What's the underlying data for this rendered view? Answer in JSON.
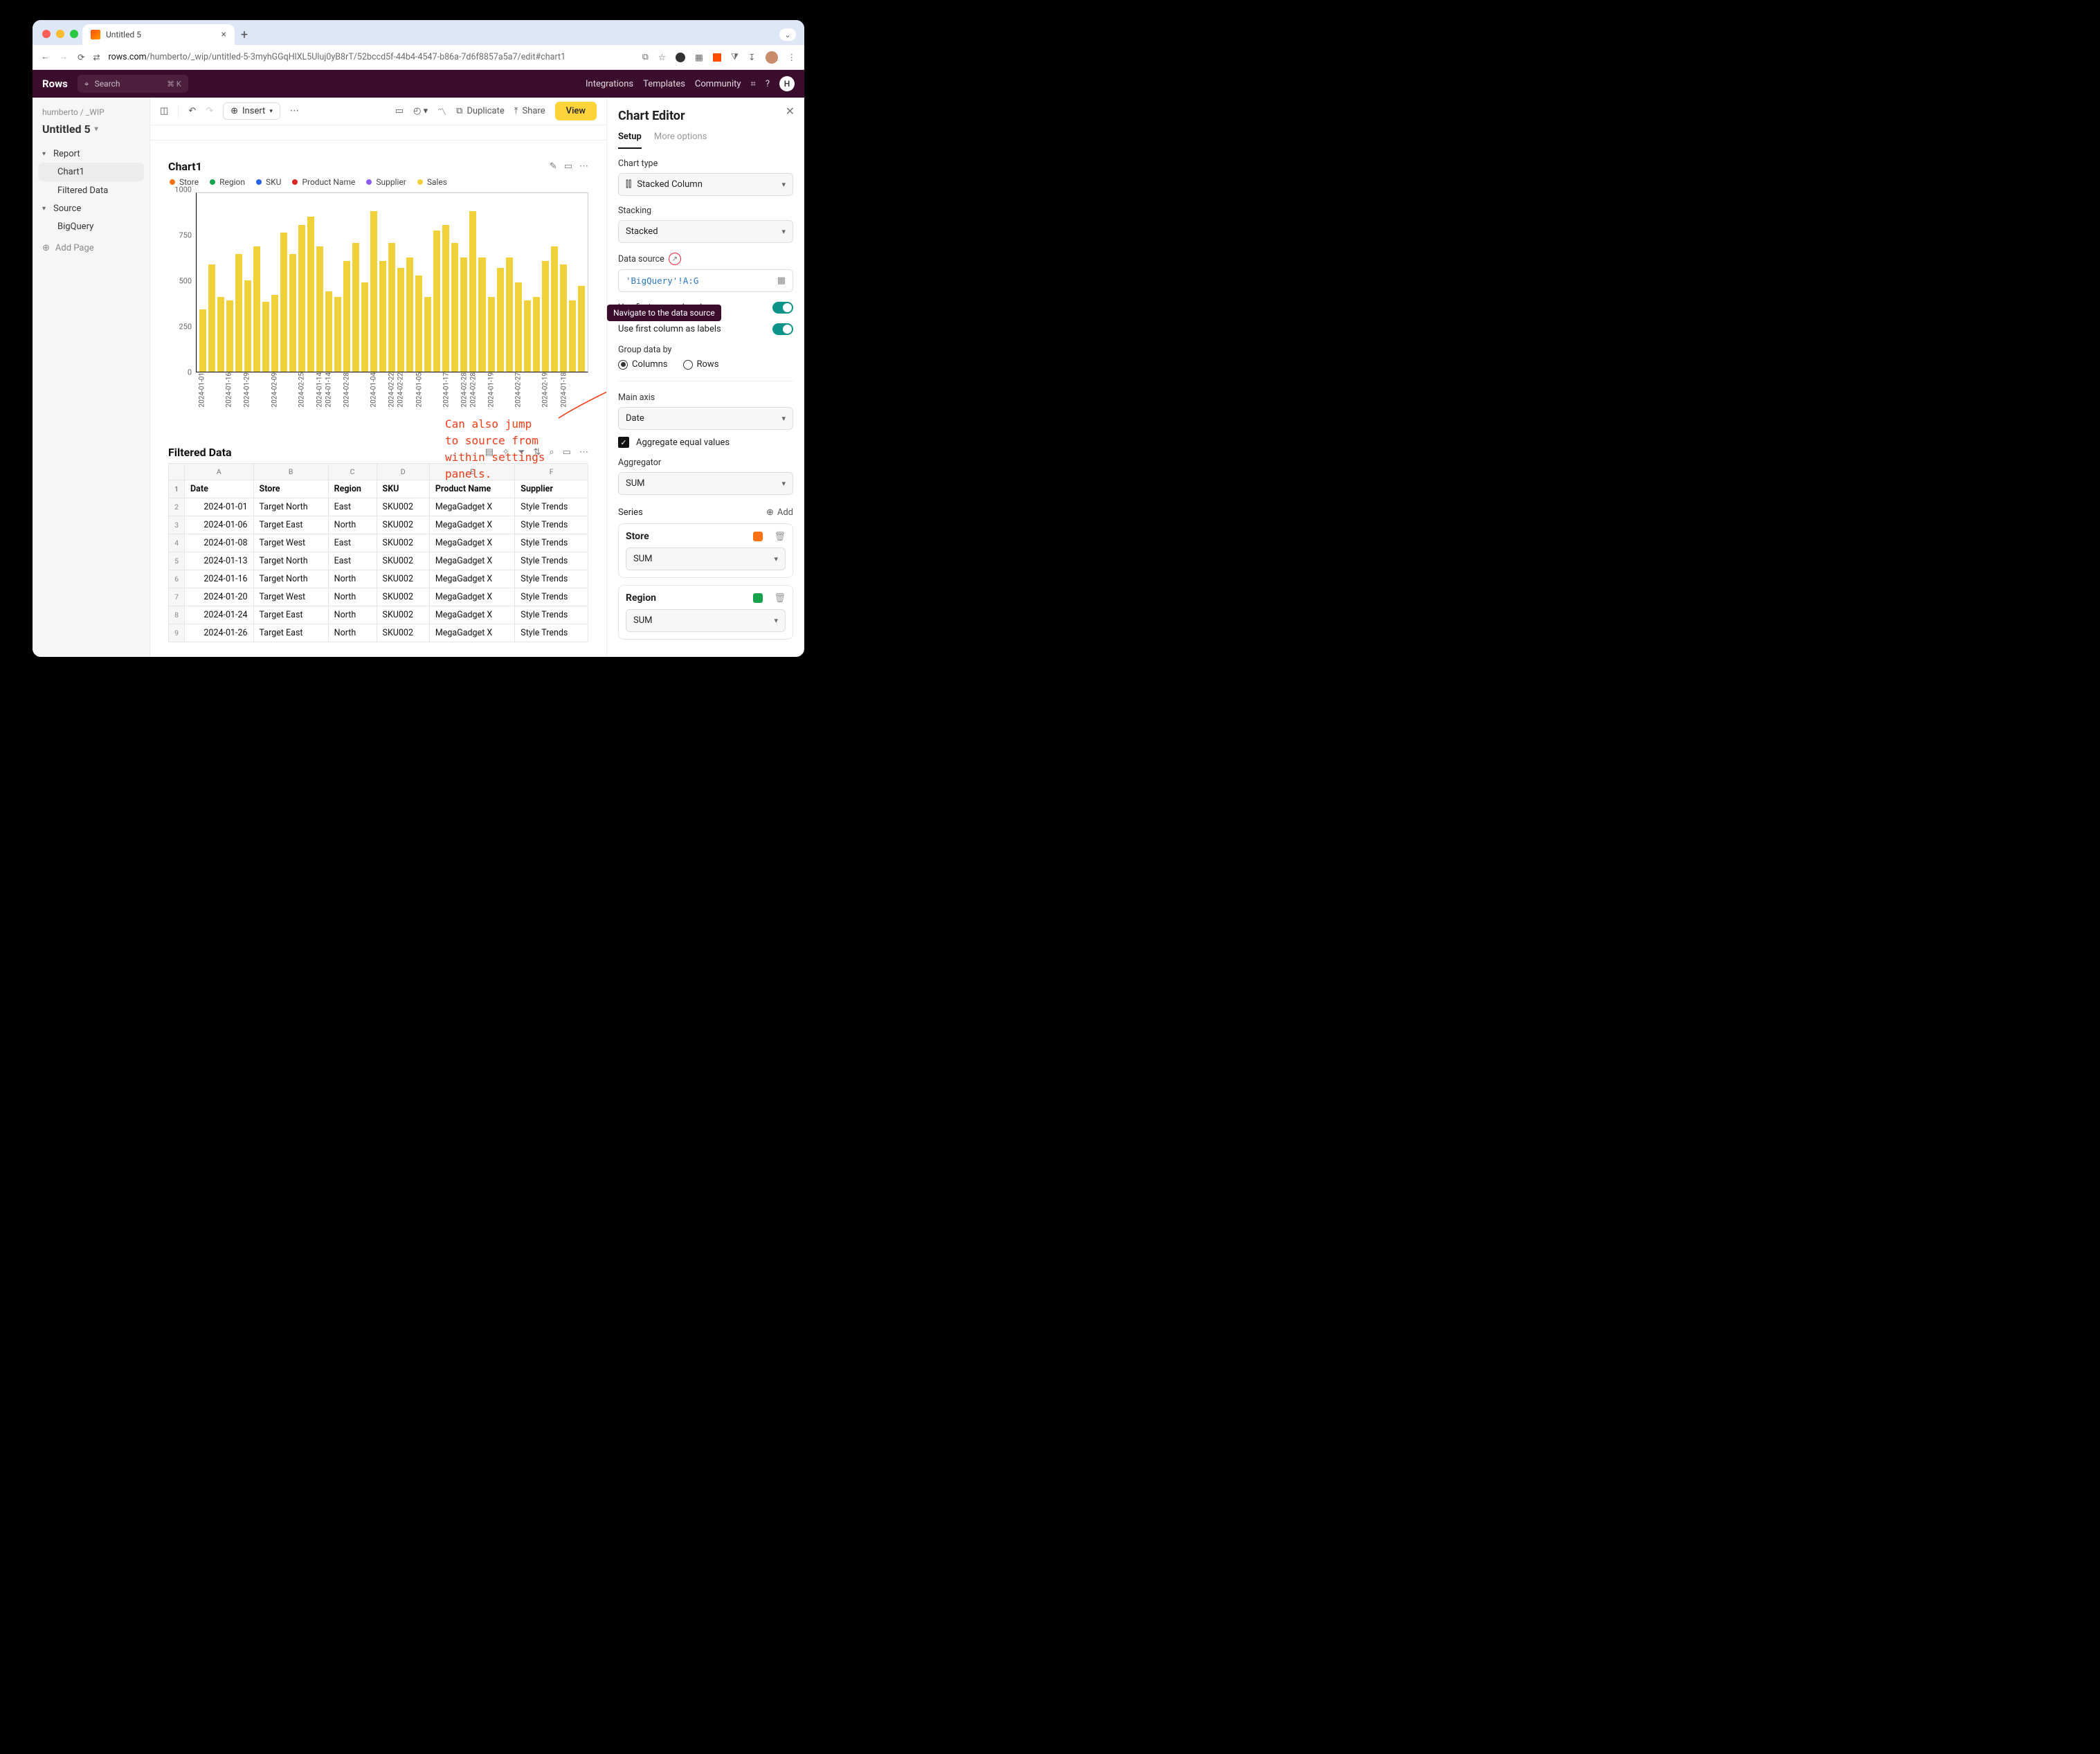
{
  "browser": {
    "tab_title": "Untitled 5",
    "url_host": "rows.com",
    "url_path": "/humberto/_wip/untitled-5-3myhGGqHlXL5Uluj0yB8rT/52bccd5f-44b4-4547-b86a-7d6f8857a5a7/edit#chart1"
  },
  "app_header": {
    "brand": "Rows",
    "search_placeholder": "Search",
    "search_kbd": "⌘ K",
    "links": [
      "Integrations",
      "Templates",
      "Community"
    ],
    "avatar_initial": "H"
  },
  "leftnav": {
    "crumb_user": "humberto",
    "crumb_folder": "_WIP",
    "doc_title": "Untitled 5",
    "sections": [
      {
        "label": "Report",
        "items": [
          "Chart1",
          "Filtered Data"
        ],
        "active_index": 0
      },
      {
        "label": "Source",
        "items": [
          "BigQuery"
        ]
      }
    ],
    "add_page": "Add Page"
  },
  "doc_toolbar": {
    "insert": "Insert",
    "duplicate": "Duplicate",
    "share": "Share",
    "view": "View"
  },
  "chart_block": {
    "title": "Chart1",
    "legend": [
      {
        "label": "Store",
        "color": "#f97316"
      },
      {
        "label": "Region",
        "color": "#16a34a"
      },
      {
        "label": "SKU",
        "color": "#2563eb"
      },
      {
        "label": "Product Name",
        "color": "#dc2626"
      },
      {
        "label": "Supplier",
        "color": "#8b5cf6"
      },
      {
        "label": "Sales",
        "color": "#f1d13a"
      }
    ]
  },
  "chart_data": {
    "type": "bar",
    "title": "",
    "xlabel": "",
    "ylabel": "",
    "ylim": [
      0,
      1000
    ],
    "yticks": [
      0,
      250,
      500,
      750,
      1000
    ],
    "xlabels_visible": [
      "2024-01-01",
      "2024-01-16",
      "2024-01-29",
      "2024-02-09",
      "2024-02-25",
      "2024-01-14",
      "2024-02-28",
      "2024-01-04",
      "2024-02-22",
      "2024-01-05",
      "2024-01-17",
      "2024-02-28",
      "2024-01-19",
      "2024-02-27",
      "2024-02-19",
      "2024-01-18"
    ],
    "categories": [
      "2024-01-01",
      "",
      "2024-01-16",
      "",
      "2024-01-29",
      "",
      "2024-02-09",
      "",
      "2024-02-25",
      "",
      "2024-01-14",
      "",
      "2024-02-28",
      "",
      "2024-01-04",
      "",
      "2024-02-22",
      "",
      "2024-01-05",
      "",
      "2024-01-17",
      "",
      "2024-02-28",
      "",
      "2024-01-19",
      "",
      "2024-02-27",
      "",
      "2024-02-19",
      "",
      "2024-01-18",
      ""
    ],
    "series": [
      {
        "name": "Sales",
        "color": "#f1d13a",
        "values": [
          350,
          600,
          420,
          400,
          660,
          510,
          700,
          390,
          430,
          780,
          660,
          820,
          870,
          700,
          450,
          420,
          620,
          720,
          500,
          900,
          620,
          720,
          580,
          640,
          540,
          420,
          790,
          820,
          720,
          640,
          900,
          640,
          420,
          580,
          640,
          500,
          400,
          420,
          620,
          700,
          600,
          400,
          480
        ]
      }
    ]
  },
  "chart_full_series": [
    350,
    600,
    420,
    400,
    660,
    510,
    700,
    390,
    430,
    780,
    660,
    820,
    870,
    700,
    450,
    420,
    620,
    720,
    500,
    900,
    620,
    720,
    580,
    640,
    540,
    420,
    790,
    820,
    720,
    640,
    900,
    640,
    420,
    580,
    640,
    500,
    400,
    420,
    620,
    700,
    600,
    400,
    480
  ],
  "annotation": {
    "l1": "Can also jump",
    "l2": "to source from",
    "l3": "within settings",
    "l4": "panels."
  },
  "table_block": {
    "title": "Filtered Data",
    "col_letters": [
      "A",
      "B",
      "C",
      "D",
      "E",
      "F"
    ],
    "headers": [
      "Date",
      "Store",
      "Region",
      "SKU",
      "Product Name",
      "Supplier"
    ],
    "rows": [
      [
        "2024-01-01",
        "Target North",
        "East",
        "SKU002",
        "MegaGadget X",
        "Style Trends"
      ],
      [
        "2024-01-06",
        "Target East",
        "North",
        "SKU002",
        "MegaGadget X",
        "Style Trends"
      ],
      [
        "2024-01-08",
        "Target West",
        "East",
        "SKU002",
        "MegaGadget X",
        "Style Trends"
      ],
      [
        "2024-01-13",
        "Target North",
        "East",
        "SKU002",
        "MegaGadget X",
        "Style Trends"
      ],
      [
        "2024-01-16",
        "Target North",
        "North",
        "SKU002",
        "MegaGadget X",
        "Style Trends"
      ],
      [
        "2024-01-20",
        "Target West",
        "North",
        "SKU002",
        "MegaGadget X",
        "Style Trends"
      ],
      [
        "2024-01-24",
        "Target East",
        "North",
        "SKU002",
        "MegaGadget X",
        "Style Trends"
      ],
      [
        "2024-01-26",
        "Target East",
        "North",
        "SKU002",
        "MegaGadget X",
        "Style Trends"
      ]
    ]
  },
  "rightpanel": {
    "title": "Chart Editor",
    "tabs": [
      "Setup",
      "More options"
    ],
    "chart_type_label": "Chart type",
    "chart_type_value": "Stacked Column",
    "stacking_label": "Stacking",
    "stacking_value": "Stacked",
    "data_source_label": "Data source",
    "data_source_value": "'BigQuery'!A:G",
    "tooltip": "Navigate to the data source",
    "first_row_label": "Use first row as headers",
    "first_col_label": "Use first column as labels",
    "group_by_label": "Group data by",
    "group_by_options": [
      "Columns",
      "Rows"
    ],
    "group_by_selected": "Columns",
    "main_axis_label": "Main axis",
    "main_axis_value": "Date",
    "aggregate_label": "Aggregate equal values",
    "aggregator_label": "Aggregator",
    "aggregator_value": "SUM",
    "series_label": "Series",
    "add_label": "Add",
    "series": [
      {
        "name": "Store",
        "color": "#f97316",
        "agg": "SUM"
      },
      {
        "name": "Region",
        "color": "#16a34a",
        "agg": "SUM"
      }
    ]
  }
}
